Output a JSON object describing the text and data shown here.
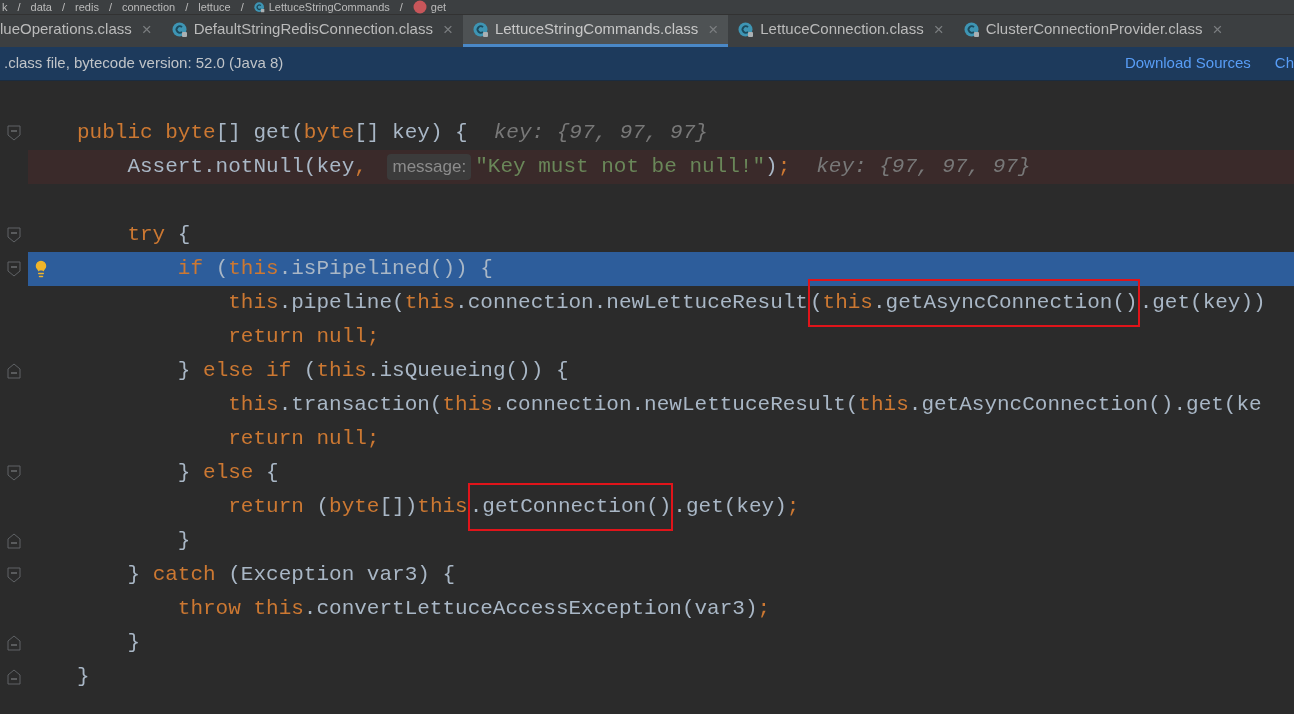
{
  "breadcrumb": {
    "separator": "/",
    "items": [
      {
        "kind": "folder",
        "label": "k"
      },
      {
        "kind": "folder",
        "label": "data"
      },
      {
        "kind": "folder",
        "label": "redis"
      },
      {
        "kind": "folder",
        "label": "connection"
      },
      {
        "kind": "folder",
        "label": "lettuce"
      },
      {
        "kind": "class",
        "label": "LettuceStringCommands"
      },
      {
        "kind": "method",
        "label": "get"
      }
    ]
  },
  "tabs": [
    {
      "label": "lueOperations.class",
      "icon": false,
      "selected": false
    },
    {
      "label": "DefaultStringRedisConnection.class",
      "icon": true,
      "selected": false
    },
    {
      "label": "LettuceStringCommands.class",
      "icon": true,
      "selected": true
    },
    {
      "label": "LettuceConnection.class",
      "icon": true,
      "selected": false
    },
    {
      "label": "ClusterConnectionProvider.class",
      "icon": true,
      "selected": false
    }
  ],
  "tab_close": "×",
  "banner": {
    "text": ".class file, bytecode version: 52.0 (Java 8)",
    "links": [
      "Download Sources",
      "Ch"
    ]
  },
  "lines": [
    {
      "current": false,
      "error": false,
      "fold_open": true,
      "fold_close": false,
      "bulb": false,
      "groups": [
        {
          "kind": "code",
          "tokens": [
            {
              "kind": "kw",
              "text": "public byte"
            },
            {
              "kind": "plain",
              "text": "[] get("
            },
            {
              "kind": "kw",
              "text": "byte"
            },
            {
              "kind": "plain",
              "text": "[] key) {"
            }
          ]
        },
        {
          "kind": "debug",
          "text": "key: {97, 97, 97}"
        }
      ]
    },
    {
      "current": false,
      "error": true,
      "fold_open": false,
      "fold_close": false,
      "bulb": false,
      "groups": [
        {
          "kind": "code",
          "tokens": [
            {
              "kind": "plain",
              "text": "    Assert.notNull(key"
            },
            {
              "kind": "kw",
              "text": ", "
            }
          ]
        },
        {
          "kind": "inlay",
          "text": "message:"
        },
        {
          "kind": "code",
          "tokens": [
            {
              "kind": "str",
              "text": "\"Key must not be null!\""
            },
            {
              "kind": "plain",
              "text": ")"
            },
            {
              "kind": "kw",
              "text": ";"
            }
          ]
        },
        {
          "kind": "debug",
          "text": "key: {97, 97, 97}"
        }
      ]
    },
    {
      "current": false,
      "error": false,
      "fold_open": false,
      "fold_close": false,
      "bulb": false
    },
    {
      "current": false,
      "error": false,
      "fold_open": true,
      "fold_close": false,
      "bulb": false,
      "groups": [
        {
          "kind": "code",
          "tokens": [
            {
              "kind": "kw",
              "text": "    try "
            },
            {
              "kind": "plain",
              "text": "{"
            }
          ]
        }
      ]
    },
    {
      "current": true,
      "error": false,
      "fold_open": true,
      "fold_close": false,
      "bulb": true,
      "groups": [
        {
          "kind": "code",
          "tokens": [
            {
              "kind": "kw",
              "text": "        if "
            },
            {
              "kind": "plain",
              "text": "("
            },
            {
              "kind": "kw",
              "text": "this"
            },
            {
              "kind": "plain",
              "text": ".isPipelined()) {"
            }
          ]
        }
      ]
    },
    {
      "current": false,
      "error": false,
      "fold_open": false,
      "fold_close": false,
      "bulb": false,
      "groups": [
        {
          "kind": "code",
          "tokens": [
            {
              "kind": "kw",
              "text": "            this"
            },
            {
              "kind": "plain",
              "text": ".pipeline("
            },
            {
              "kind": "kw",
              "text": "this"
            },
            {
              "kind": "plain",
              "text": ".connection.newLettuceResult"
            }
          ]
        },
        {
          "kind": "boxed",
          "tokens": [
            {
              "kind": "plain",
              "text": "("
            },
            {
              "kind": "kw",
              "text": "this"
            },
            {
              "kind": "plain",
              "text": ".getAsyncConnection()"
            }
          ]
        },
        {
          "kind": "code",
          "tokens": [
            {
              "kind": "plain",
              "text": ".get(key))"
            }
          ]
        }
      ]
    },
    {
      "current": false,
      "error": false,
      "fold_open": false,
      "fold_close": false,
      "bulb": false,
      "groups": [
        {
          "kind": "code",
          "tokens": [
            {
              "kind": "kw",
              "text": "            return null;"
            }
          ]
        }
      ]
    },
    {
      "current": false,
      "error": false,
      "fold_open": false,
      "fold_close": true,
      "bulb": false,
      "groups": [
        {
          "kind": "code",
          "tokens": [
            {
              "kind": "plain",
              "text": "        } "
            },
            {
              "kind": "kw",
              "text": "else if "
            },
            {
              "kind": "plain",
              "text": "("
            },
            {
              "kind": "kw",
              "text": "this"
            },
            {
              "kind": "plain",
              "text": ".isQueueing()) {"
            }
          ]
        }
      ]
    },
    {
      "current": false,
      "error": false,
      "fold_open": false,
      "fold_close": false,
      "bulb": false,
      "groups": [
        {
          "kind": "code",
          "tokens": [
            {
              "kind": "kw",
              "text": "            this"
            },
            {
              "kind": "plain",
              "text": ".transaction("
            },
            {
              "kind": "kw",
              "text": "this"
            },
            {
              "kind": "plain",
              "text": ".connection.newLettuceResult("
            },
            {
              "kind": "kw",
              "text": "this"
            },
            {
              "kind": "plain",
              "text": ".getAsyncConnection().get(ke"
            }
          ]
        }
      ]
    },
    {
      "current": false,
      "error": false,
      "fold_open": false,
      "fold_close": false,
      "bulb": false,
      "groups": [
        {
          "kind": "code",
          "tokens": [
            {
              "kind": "kw",
              "text": "            return null;"
            }
          ]
        }
      ]
    },
    {
      "current": false,
      "error": false,
      "fold_open": true,
      "fold_close": false,
      "bulb": false,
      "groups": [
        {
          "kind": "code",
          "tokens": [
            {
              "kind": "plain",
              "text": "        } "
            },
            {
              "kind": "kw",
              "text": "else "
            },
            {
              "kind": "plain",
              "text": "{"
            }
          ]
        }
      ]
    },
    {
      "current": false,
      "error": false,
      "fold_open": false,
      "fold_close": false,
      "bulb": false,
      "groups": [
        {
          "kind": "code",
          "tokens": [
            {
              "kind": "kw",
              "text": "            return "
            },
            {
              "kind": "plain",
              "text": "("
            },
            {
              "kind": "kw",
              "text": "byte"
            },
            {
              "kind": "plain",
              "text": "[])"
            },
            {
              "kind": "kw",
              "text": "this"
            }
          ]
        },
        {
          "kind": "boxed",
          "tokens": [
            {
              "kind": "plain",
              "text": ".getConnection()"
            }
          ]
        },
        {
          "kind": "code",
          "tokens": [
            {
              "kind": "plain",
              "text": ".get(key)"
            },
            {
              "kind": "kw",
              "text": ";"
            }
          ]
        }
      ]
    },
    {
      "current": false,
      "error": false,
      "fold_open": false,
      "fold_close": true,
      "bulb": false,
      "groups": [
        {
          "kind": "code",
          "tokens": [
            {
              "kind": "plain",
              "text": "        }"
            }
          ]
        }
      ]
    },
    {
      "current": false,
      "error": false,
      "fold_open": true,
      "fold_close": false,
      "bulb": false,
      "groups": [
        {
          "kind": "code",
          "tokens": [
            {
              "kind": "plain",
              "text": "    } "
            },
            {
              "kind": "kw",
              "text": "catch "
            },
            {
              "kind": "plain",
              "text": "(Exception var3) {"
            }
          ]
        }
      ]
    },
    {
      "current": false,
      "error": false,
      "fold_open": false,
      "fold_close": false,
      "bulb": false,
      "groups": [
        {
          "kind": "code",
          "tokens": [
            {
              "kind": "kw",
              "text": "        throw this"
            },
            {
              "kind": "plain",
              "text": ".convertLettuceAccessException(var3)"
            },
            {
              "kind": "kw",
              "text": ";"
            }
          ]
        }
      ]
    },
    {
      "current": false,
      "error": false,
      "fold_open": false,
      "fold_close": true,
      "bulb": false,
      "groups": [
        {
          "kind": "code",
          "tokens": [
            {
              "kind": "plain",
              "text": "    }"
            }
          ]
        }
      ]
    },
    {
      "current": false,
      "error": false,
      "fold_open": false,
      "fold_close": true,
      "bulb": false,
      "groups": [
        {
          "kind": "code",
          "tokens": [
            {
              "kind": "plain",
              "text": "}"
            }
          ]
        }
      ]
    }
  ]
}
